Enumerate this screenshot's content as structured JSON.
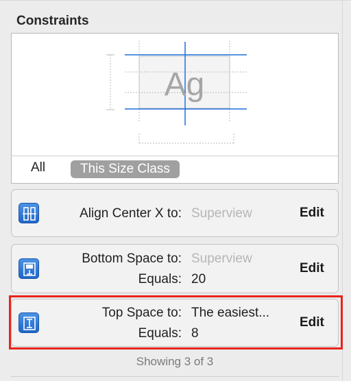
{
  "panel": {
    "title": "Constraints",
    "preview_glyph": "Ag",
    "tabs": {
      "all": "All",
      "size_class": "This Size Class"
    }
  },
  "constraints": [
    {
      "icon": "align-center-x-icon",
      "label": "Align Center X to:",
      "target": "Superview",
      "edit": "Edit"
    },
    {
      "icon": "bottom-space-icon",
      "label": "Bottom Space to:",
      "target": "Superview",
      "equals_label": "Equals:",
      "equals_value": "20",
      "edit": "Edit"
    },
    {
      "icon": "top-space-icon",
      "label": "Top Space to:",
      "target": "The easiest...",
      "equals_label": "Equals:",
      "equals_value": "8",
      "edit": "Edit"
    }
  ],
  "status": "Showing 3 of 3",
  "colors": {
    "guide_blue": "#1e6fd9",
    "icon_blue": "#2b78dc",
    "highlight_red": "#e8231b",
    "muted_text": "#b6b6b6"
  }
}
